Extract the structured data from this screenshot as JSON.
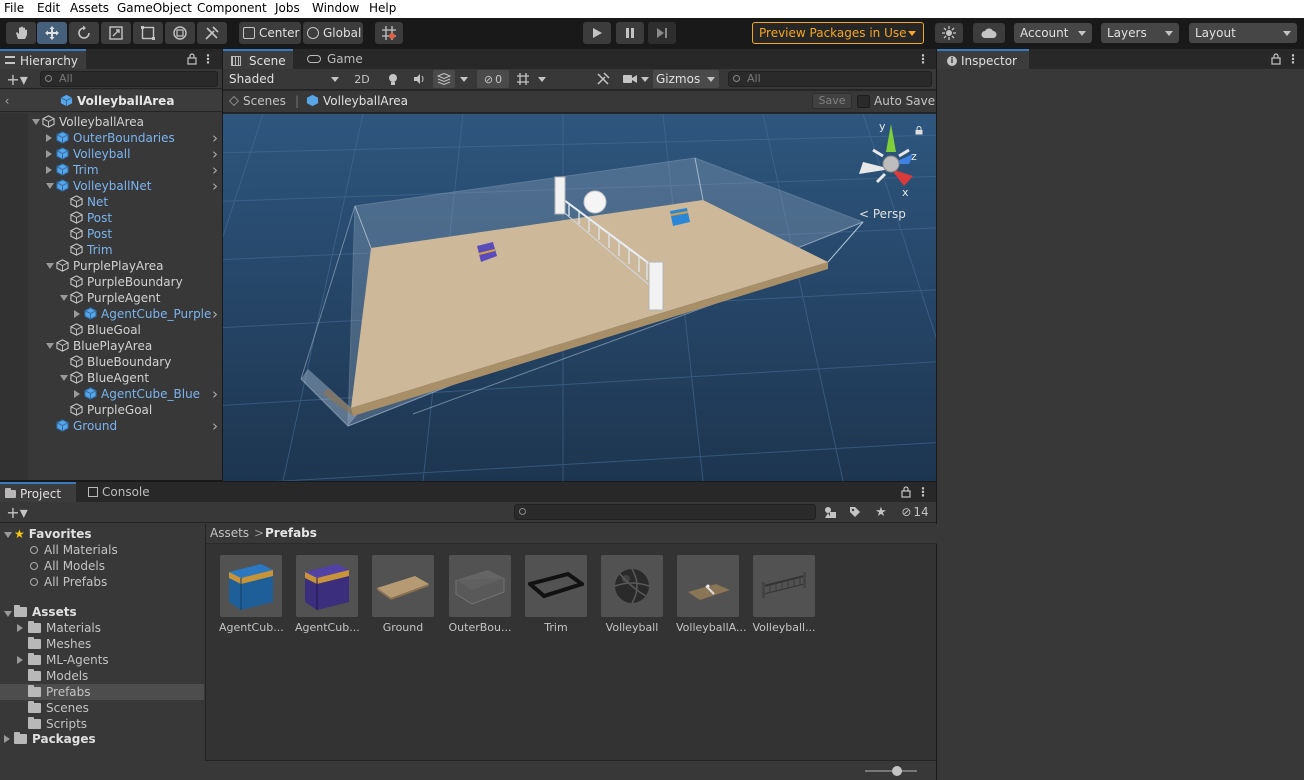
{
  "menu": [
    "File",
    "Edit",
    "Assets",
    "GameObject",
    "Component",
    "Jobs",
    "Window",
    "Help"
  ],
  "toolbar": {
    "pivot_label": "Center",
    "space_label": "Global",
    "preview_label": "Preview Packages in Use",
    "account_label": "Account",
    "layers_label": "Layers",
    "layout_label": "Layout"
  },
  "hierarchy": {
    "tab_label": "Hierarchy",
    "search_placeholder": "All",
    "scene_title": "VolleyballArea",
    "items": [
      {
        "label": "VolleyballArea",
        "blue": false,
        "depth": 0,
        "arrow": "down",
        "chev": false,
        "prefab": false
      },
      {
        "label": "OuterBoundaries",
        "blue": true,
        "depth": 1,
        "arrow": "right",
        "chev": true,
        "prefab": true
      },
      {
        "label": "Volleyball",
        "blue": true,
        "depth": 1,
        "arrow": "right",
        "chev": true,
        "prefab": true
      },
      {
        "label": "Trim",
        "blue": true,
        "depth": 1,
        "arrow": "right",
        "chev": true,
        "prefab": true
      },
      {
        "label": "VolleyballNet",
        "blue": true,
        "depth": 1,
        "arrow": "down",
        "chev": true,
        "prefab": true
      },
      {
        "label": "Net",
        "blue": true,
        "depth": 2,
        "arrow": "",
        "chev": false,
        "prefab": false
      },
      {
        "label": "Post",
        "blue": true,
        "depth": 2,
        "arrow": "",
        "chev": false,
        "prefab": false
      },
      {
        "label": "Post",
        "blue": true,
        "depth": 2,
        "arrow": "",
        "chev": false,
        "prefab": false
      },
      {
        "label": "Trim",
        "blue": true,
        "depth": 2,
        "arrow": "",
        "chev": false,
        "prefab": false
      },
      {
        "label": "PurplePlayArea",
        "blue": false,
        "depth": 1,
        "arrow": "down",
        "chev": false,
        "prefab": false
      },
      {
        "label": "PurpleBoundary",
        "blue": false,
        "depth": 2,
        "arrow": "",
        "chev": false,
        "prefab": false
      },
      {
        "label": "PurpleAgent",
        "blue": false,
        "depth": 2,
        "arrow": "down",
        "chev": false,
        "prefab": false
      },
      {
        "label": "AgentCube_Purple",
        "blue": true,
        "depth": 3,
        "arrow": "right",
        "chev": true,
        "prefab": true
      },
      {
        "label": "BlueGoal",
        "blue": false,
        "depth": 2,
        "arrow": "",
        "chev": false,
        "prefab": false
      },
      {
        "label": "BluePlayArea",
        "blue": false,
        "depth": 1,
        "arrow": "down",
        "chev": false,
        "prefab": false
      },
      {
        "label": "BlueBoundary",
        "blue": false,
        "depth": 2,
        "arrow": "",
        "chev": false,
        "prefab": false
      },
      {
        "label": "BlueAgent",
        "blue": false,
        "depth": 2,
        "arrow": "down",
        "chev": false,
        "prefab": false
      },
      {
        "label": "AgentCube_Blue",
        "blue": true,
        "depth": 3,
        "arrow": "right",
        "chev": true,
        "prefab": true
      },
      {
        "label": "PurpleGoal",
        "blue": false,
        "depth": 2,
        "arrow": "",
        "chev": false,
        "prefab": false
      },
      {
        "label": "Ground",
        "blue": true,
        "depth": 1,
        "arrow": "",
        "chev": true,
        "prefab": true
      }
    ]
  },
  "scene": {
    "tab_scene": "Scene",
    "tab_game": "Game",
    "shading_mode": "Shaded",
    "mode_2d": "2D",
    "hidden_count": "0",
    "gizmos_label": "Gizmos",
    "search_placeholder": "All",
    "breadcrumb_root": "Scenes",
    "breadcrumb_prefab": "VolleyballArea",
    "save_label": "Save",
    "autosave_label": "Auto Save",
    "persp_label": "Persp",
    "axis_y": "y",
    "axis_z": "z",
    "axis_x": "x"
  },
  "inspector": {
    "tab_label": "Inspector"
  },
  "project": {
    "tab_project": "Project",
    "tab_console": "Console",
    "hidden_count": "14",
    "favorites_label": "Favorites",
    "favorites": [
      "All Materials",
      "All Models",
      "All Prefabs"
    ],
    "assets_label": "Assets",
    "folders": [
      {
        "label": "Materials",
        "arrow": true,
        "selected": false
      },
      {
        "label": "Meshes",
        "arrow": false,
        "selected": false
      },
      {
        "label": "ML-Agents",
        "arrow": true,
        "selected": false
      },
      {
        "label": "Models",
        "arrow": false,
        "selected": false
      },
      {
        "label": "Prefabs",
        "arrow": false,
        "selected": true
      },
      {
        "label": "Scenes",
        "arrow": false,
        "selected": false
      },
      {
        "label": "Scripts",
        "arrow": false,
        "selected": false
      }
    ],
    "packages_label": "Packages",
    "breadcrumb_root": "Assets",
    "breadcrumb_current": "Prefabs",
    "assets": [
      "AgentCub...",
      "AgentCub...",
      "Ground",
      "OuterBou...",
      "Trim",
      "Volleyball",
      "VolleyballA...",
      "Volleyball..."
    ]
  },
  "colors": {
    "accent": "#3a79bb",
    "prefab_blue": "#7bb4f0",
    "preview_orange": "#f5a623"
  }
}
